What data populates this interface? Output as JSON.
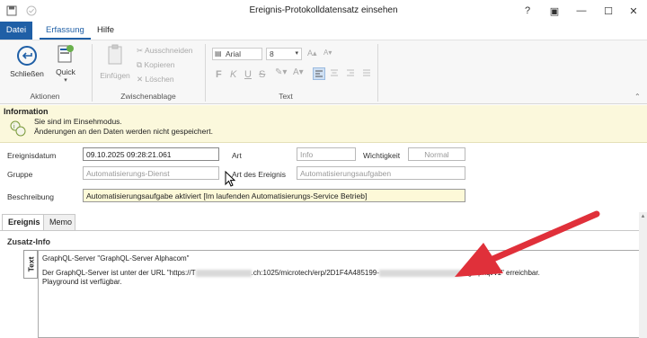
{
  "window": {
    "title": "Ereignis-Protokolldatensatz einsehen",
    "help_glyph": "?",
    "restore_glyph": "▣",
    "minimize_glyph": "—",
    "maximize_glyph": "☐",
    "close_glyph": "✕"
  },
  "ribbon_tabs": [
    {
      "label": "Datei"
    },
    {
      "label": "Erfassung"
    },
    {
      "label": "Hilfe"
    }
  ],
  "ribbon": {
    "close_label": "Schließen",
    "quick_label": "Quick",
    "actions_group": "Aktionen",
    "paste_label": "Einfügen",
    "cut_label": "Ausschneiden",
    "copy_label": "Kopieren",
    "delete_label": "Löschen",
    "clipboard_group": "Zwischenablage",
    "font_name": "Arial",
    "font_size": "8",
    "text_group": "Text",
    "bold": "F",
    "italic": "K",
    "underline": "U",
    "strike": "S"
  },
  "info": {
    "heading": "Information",
    "line1": "Sie sind im Einsehmodus.",
    "line2": "Änderungen an den Daten werden nicht gespeichert."
  },
  "form": {
    "date_label": "Ereignisdatum",
    "date_value": "09.10.2025 09:28:21.061",
    "type_label": "Art",
    "type_value": "Info",
    "priority_label": "Wichtigkeit",
    "priority_value": "Normal",
    "group_label": "Gruppe",
    "group_value": "Automatisierungs-Dienst",
    "event_type_label": "Art des Ereignis",
    "event_type_value": "Automatisierungsaufgaben",
    "desc_label": "Beschreibung",
    "desc_value": "Automatisierungsaufgabe aktiviert [Im laufenden Automatisierungs-Service Betrieb]"
  },
  "bottom_tabs": [
    {
      "label": "Ereignis"
    },
    {
      "label": "Memo"
    }
  ],
  "extra": {
    "section_label": "Zusatz-Info",
    "vertical_tab": "Text",
    "line1": "GraphQL-Server \"GraphQL-Server Alphacom\"",
    "line2_a": "Der GraphQL-Server ist unter der URL \"https://T",
    "line2_b": ".ch:1025/microtech/erp/2D1F4A485199-",
    "line2_c": "9/graphql/v1\" erreichbar.",
    "line3": "Playground ist verfügbar."
  },
  "colors": {
    "accent": "#1f5fa6",
    "info_bg": "#fbf8dc",
    "arrow": "#e0303a"
  }
}
